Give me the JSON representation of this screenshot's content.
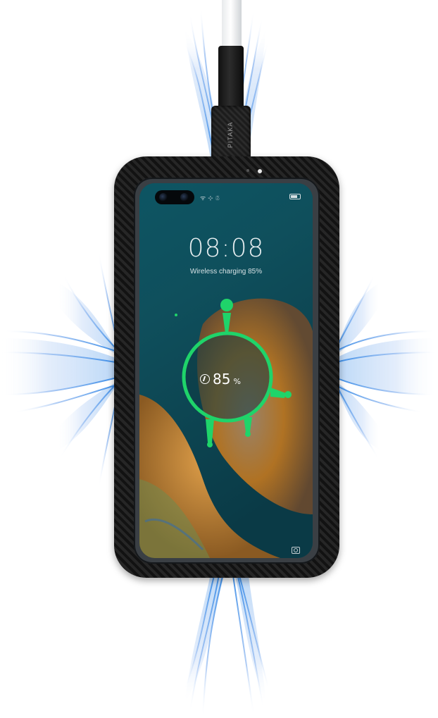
{
  "lockscreen": {
    "time": "08:08",
    "charging_status": "Wireless charging 85%",
    "battery_percent_value": "85",
    "battery_percent_sign": "%",
    "status_icons": "ᯤ ⊹ 𝔖"
  },
  "accessory": {
    "cable_brand": "PITAKA"
  },
  "colors": {
    "accent_green": "#1fd46a",
    "wave_blue": "#2f86e6",
    "case_black": "#141414",
    "screen_teal": "#0d4c58"
  },
  "icons": {
    "camera_cutout": "dual-punch-hole-camera",
    "charging": "wireless-charging-icon",
    "lockscreen_camera": "camera-icon",
    "battery": "battery-icon"
  }
}
